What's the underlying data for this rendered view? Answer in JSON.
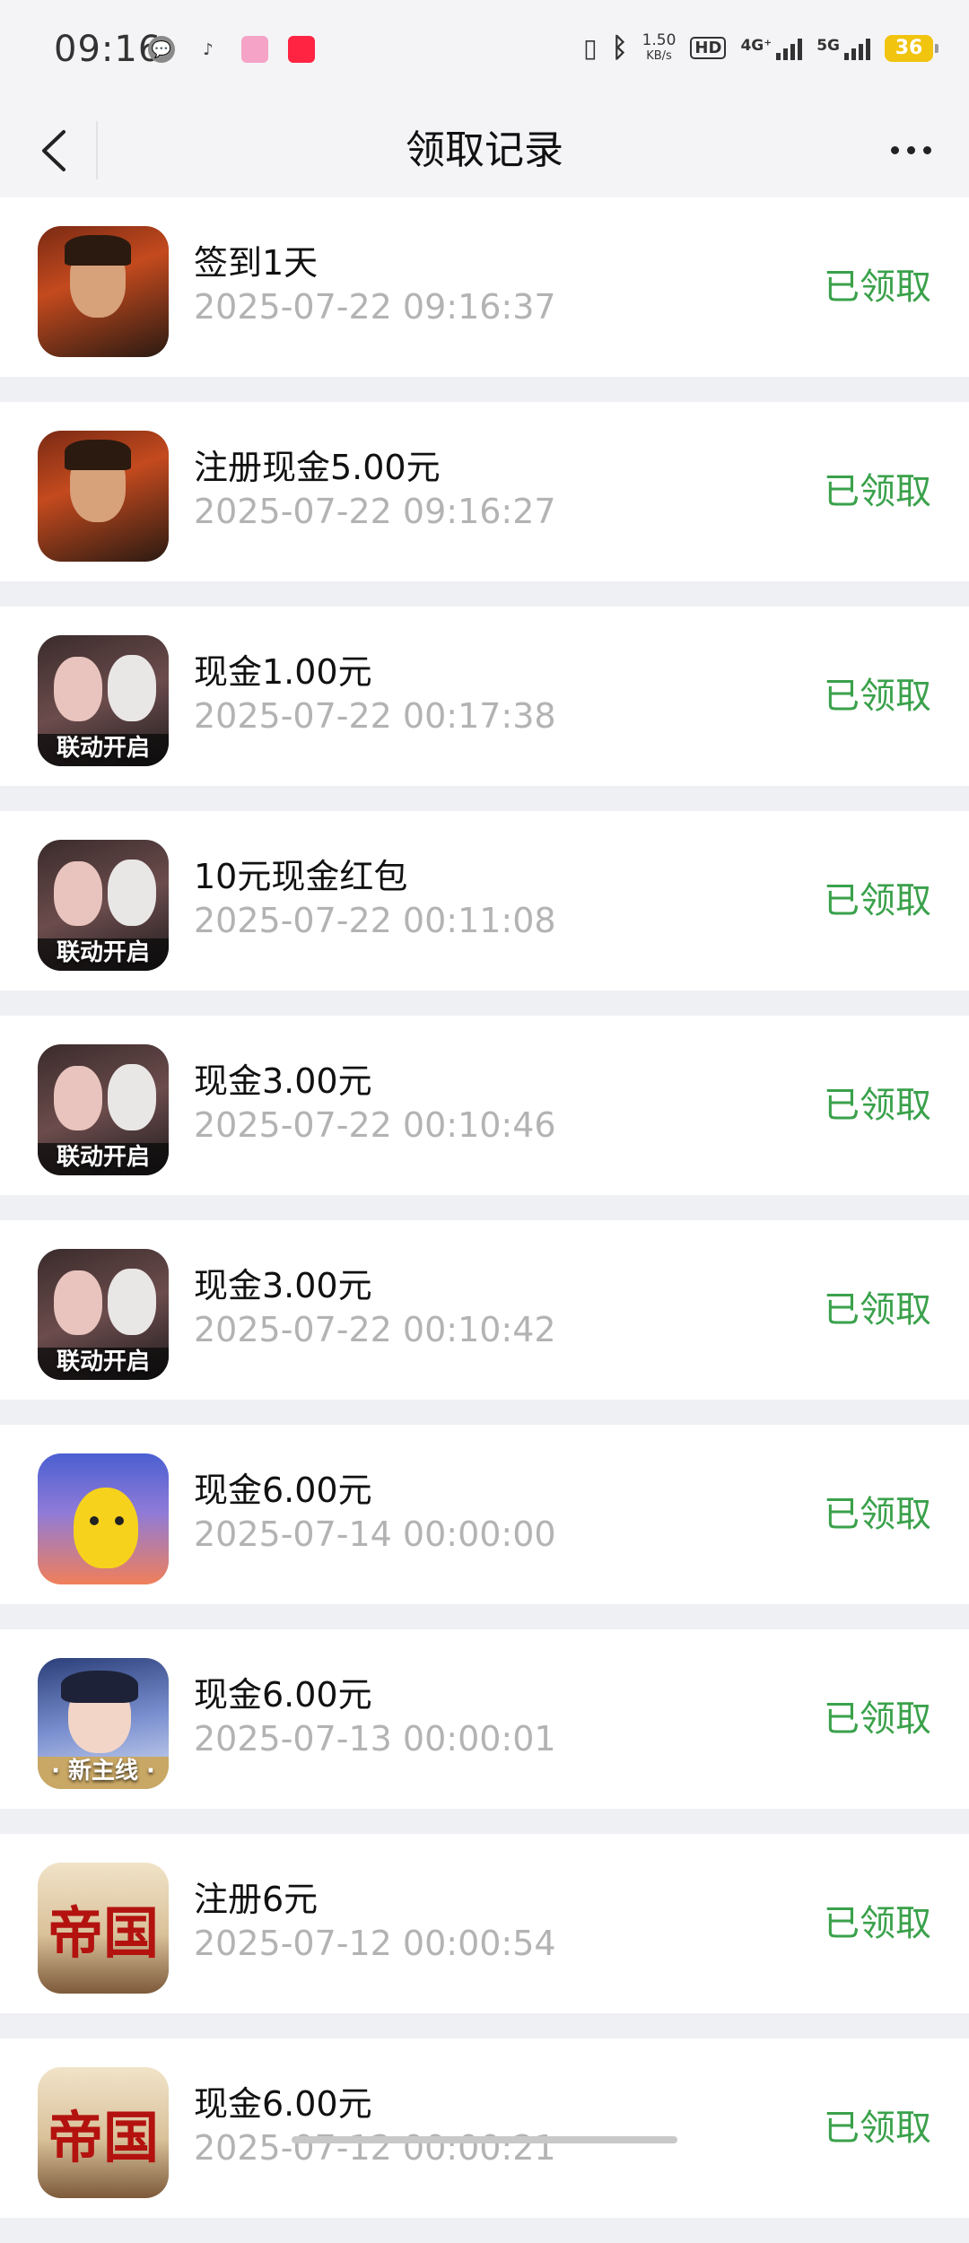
{
  "status_bar": {
    "time": "09:16",
    "net_speed_value": "1.50",
    "net_speed_unit": "KB/s",
    "hd_label": "HD",
    "signal_4g_label": "4G⁺",
    "signal_5g_label": "5G",
    "battery": "36",
    "left_icons": [
      "wechat-icon",
      "music-icon",
      "bilibili-icon",
      "xiaohongshu-icon"
    ],
    "right_icons": [
      "vibrate-icon",
      "bluetooth-icon",
      "hd-icon",
      "signal-4g-icon",
      "signal-5g-icon",
      "battery-icon"
    ]
  },
  "navbar": {
    "title": "领取记录",
    "back_icon": "chevron-left-icon",
    "more_icon": "more-dots-icon"
  },
  "colors": {
    "claimed_status": "#3aa14b",
    "time_text": "#b3b3b3",
    "background": "#eef0f4"
  },
  "records": [
    {
      "thumb": "warrior",
      "title": "签到1天",
      "time": "2025-07-22 09:16:37",
      "status": "已领取"
    },
    {
      "thumb": "warrior",
      "title": "注册现金5.00元",
      "time": "2025-07-22 09:16:27",
      "status": "已领取"
    },
    {
      "thumb": "girls",
      "badge": "联动开启",
      "title": "现金1.00元",
      "time": "2025-07-22 00:17:38",
      "status": "已领取"
    },
    {
      "thumb": "girls",
      "badge": "联动开启",
      "title": "10元现金红包",
      "time": "2025-07-22 00:11:08",
      "status": "已领取"
    },
    {
      "thumb": "girls",
      "badge": "联动开启",
      "title": "现金3.00元",
      "time": "2025-07-22 00:10:46",
      "status": "已领取"
    },
    {
      "thumb": "girls",
      "badge": "联动开启",
      "title": "现金3.00元",
      "time": "2025-07-22 00:10:42",
      "status": "已领取"
    },
    {
      "thumb": "pika",
      "title": "现金6.00元",
      "time": "2025-07-14 00:00:00",
      "status": "已领取"
    },
    {
      "thumb": "novel",
      "badge": "· 新主线 ·",
      "title": "现金6.00元",
      "time": "2025-07-13 00:00:01",
      "status": "已领取"
    },
    {
      "thumb": "empire",
      "emblem": "帝国",
      "title": "注册6元",
      "time": "2025-07-12 00:00:54",
      "status": "已领取"
    },
    {
      "thumb": "empire",
      "emblem": "帝国",
      "title": "现金6.00元",
      "time": "2025-07-12 00:00:21",
      "status": "已领取"
    }
  ]
}
